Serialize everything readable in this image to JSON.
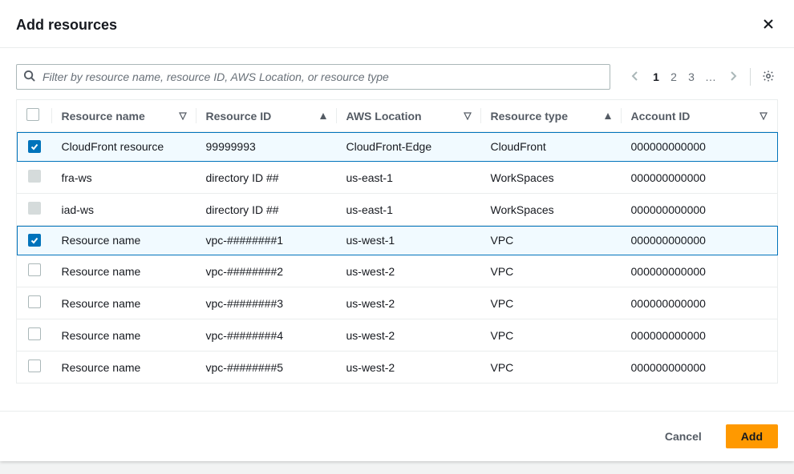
{
  "header": {
    "title": "Add resources"
  },
  "search": {
    "placeholder": "Filter by resource name, resource ID, AWS Location, or resource type"
  },
  "pager": {
    "pages": [
      "1",
      "2",
      "3",
      "…"
    ],
    "activeIndex": 0
  },
  "columns": {
    "name": "Resource name",
    "id": "Resource ID",
    "location": "AWS Location",
    "type": "Resource type",
    "account": "Account ID"
  },
  "rows": [
    {
      "state": "checked",
      "name": "CloudFront resource",
      "id": "99999993",
      "location": "CloudFront-Edge",
      "type": "CloudFront",
      "account": "000000000000"
    },
    {
      "state": "disabled",
      "name": "fra-ws",
      "id": "directory ID ##",
      "location": "us-east-1",
      "type": "WorkSpaces",
      "account": "000000000000"
    },
    {
      "state": "disabled",
      "name": "iad-ws",
      "id": "directory ID ##",
      "location": "us-east-1",
      "type": "WorkSpaces",
      "account": "000000000000"
    },
    {
      "state": "checked",
      "name": "Resource name",
      "id": "vpc-########1",
      "location": "us-west-1",
      "type": "VPC",
      "account": "000000000000"
    },
    {
      "state": "unchecked",
      "name": "Resource name",
      "id": "vpc-########2",
      "location": "us-west-2",
      "type": "VPC",
      "account": "000000000000"
    },
    {
      "state": "unchecked",
      "name": "Resource name",
      "id": "vpc-########3",
      "location": "us-west-2",
      "type": "VPC",
      "account": "000000000000"
    },
    {
      "state": "unchecked",
      "name": "Resource name",
      "id": "vpc-########4",
      "location": "us-west-2",
      "type": "VPC",
      "account": "000000000000"
    },
    {
      "state": "unchecked",
      "name": "Resource name",
      "id": "vpc-########5",
      "location": "us-west-2",
      "type": "VPC",
      "account": "000000000000"
    }
  ],
  "footer": {
    "cancel": "Cancel",
    "add": "Add"
  }
}
